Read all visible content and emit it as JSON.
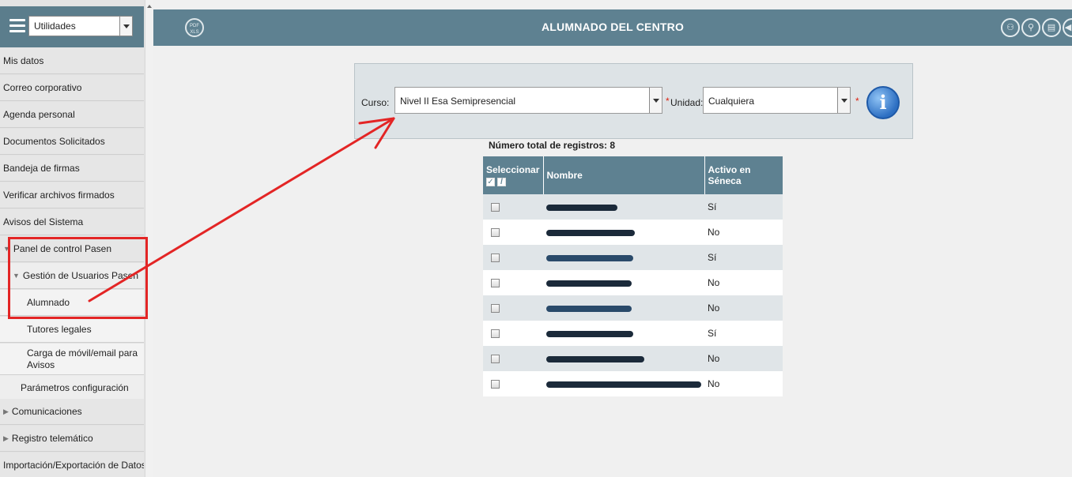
{
  "sidebar": {
    "module_select": "Utilidades",
    "items": [
      {
        "label": "Mis datos"
      },
      {
        "label": "Correo corporativo"
      },
      {
        "label": "Agenda personal"
      },
      {
        "label": "Documentos Solicitados"
      },
      {
        "label": "Bandeja de firmas"
      },
      {
        "label": "Verificar archivos firmados"
      },
      {
        "label": "Avisos del Sistema"
      },
      {
        "label": "Panel de control Pasen"
      },
      {
        "label": "Gestión de Usuarios Pasen"
      },
      {
        "label": "Alumnado"
      },
      {
        "label": "Tutores legales"
      },
      {
        "label": "Carga de móvil/email para Avisos"
      },
      {
        "label": "Parámetros configuración"
      },
      {
        "label": "Comunicaciones"
      },
      {
        "label": "Registro telemático"
      },
      {
        "label": "Importación/Exportación de Datos"
      }
    ]
  },
  "header": {
    "title": "ALUMNADO DEL CENTRO",
    "pdf_icon_text": "PDF XLS",
    "icons": [
      "users-icon",
      "search-user-icon",
      "document-icon",
      "back-icon"
    ]
  },
  "filter": {
    "curso_label": "Curso:",
    "curso_value": "Nivel II Esa Semipresencial",
    "required_mark": "*",
    "unidad_label": "Unidad:",
    "unidad_value": "Cualquiera"
  },
  "results": {
    "total_text": "Número total de registros: 8"
  },
  "table": {
    "headers": {
      "select": "Seleccionar",
      "name": "Nombre",
      "active": "Activo en Séneca"
    },
    "rows": [
      {
        "active": "Sí"
      },
      {
        "active": "No"
      },
      {
        "active": "Sí"
      },
      {
        "active": "No"
      },
      {
        "active": "No"
      },
      {
        "active": "Sí"
      },
      {
        "active": "No"
      },
      {
        "active": "No"
      }
    ]
  },
  "colors": {
    "header_bg": "#5e8191",
    "annotation_red": "#e32525"
  }
}
